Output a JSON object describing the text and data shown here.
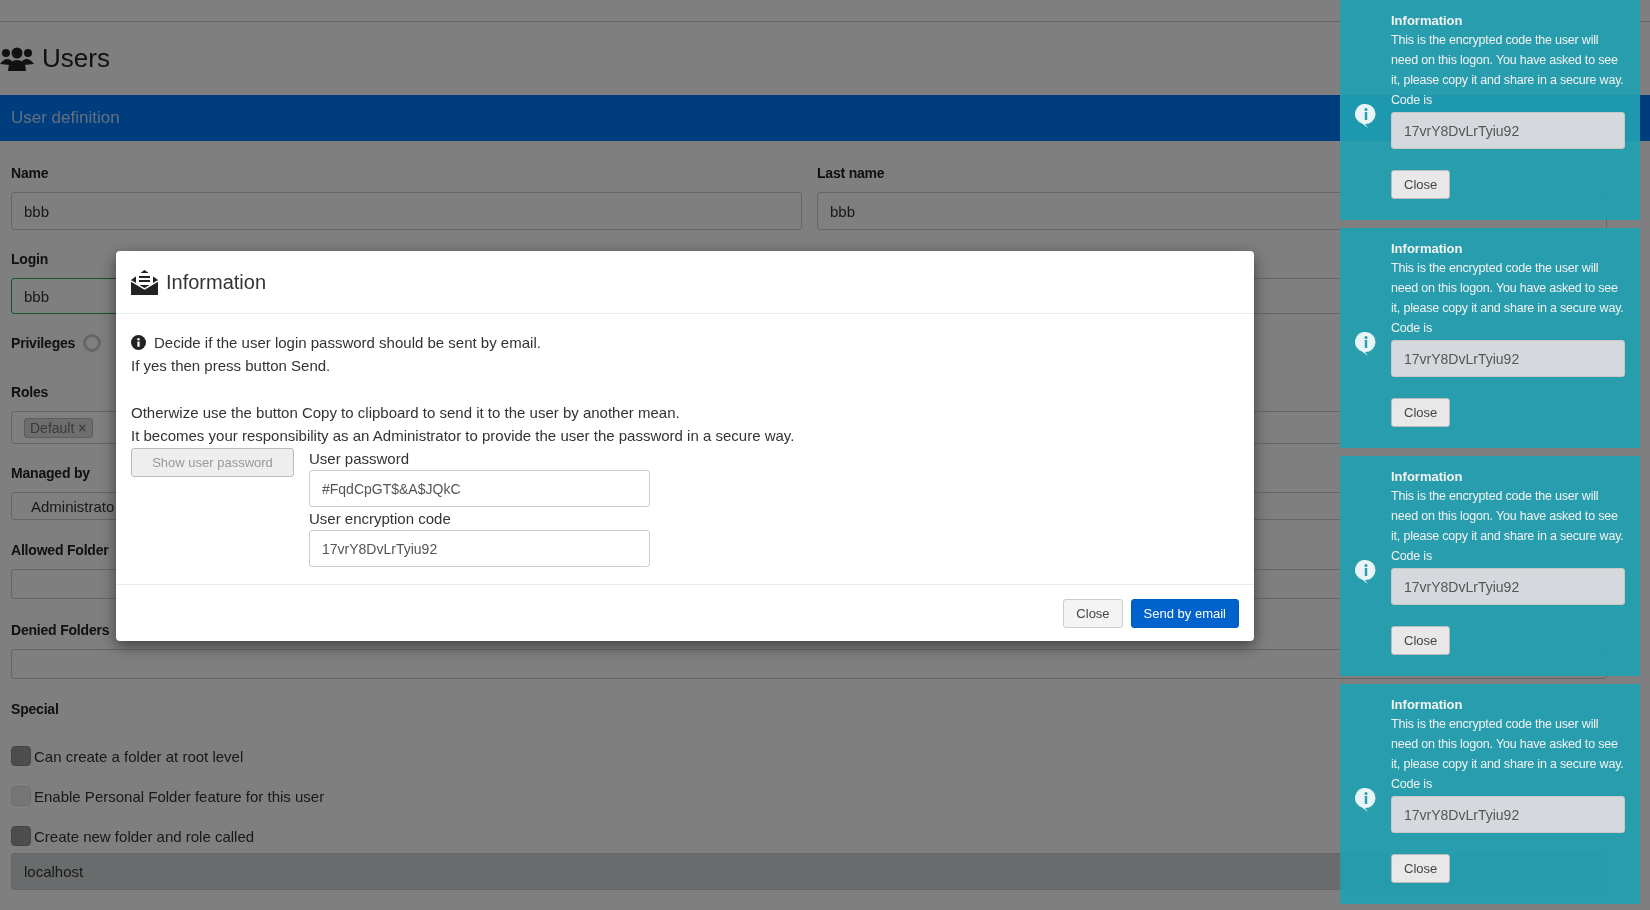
{
  "page": {
    "title": "Users"
  },
  "section": {
    "title": "User definition"
  },
  "form": {
    "name": {
      "label": "Name",
      "value": "bbb"
    },
    "last_name": {
      "label": "Last name",
      "value": "bbb"
    },
    "login": {
      "label": "Login",
      "value": "bbb",
      "valid": true
    },
    "privileges": {
      "label": "Privileges",
      "options": [
        {
          "selected": false
        }
      ]
    },
    "roles": {
      "label": "Roles",
      "tags": [
        {
          "label": "Default",
          "remove": "×"
        }
      ]
    },
    "managed_by": {
      "label": "Managed by",
      "value": "Administrato"
    },
    "allowed_folders": {
      "label": "Allowed Folder"
    },
    "denied_folders": {
      "label": "Denied Folders"
    },
    "special": {
      "label": "Special",
      "options": [
        {
          "label": "Can create a folder at root level",
          "checked": false,
          "disabled": false
        },
        {
          "label": "Enable Personal Folder feature for this user",
          "checked": false,
          "disabled": true
        },
        {
          "label": "Create new folder and role called",
          "checked": false,
          "disabled": false
        }
      ]
    },
    "new_folder": {
      "value": "localhost",
      "disabled": true
    }
  },
  "modal": {
    "title": "Information",
    "intro": [
      "Decide if the user login password should be sent by email.",
      "If yes then press button Send."
    ],
    "details": [
      "Otherwize use the button Copy to clipboard to send it to the user by another mean.",
      "It becomes your responsibility as an Administrator to provide the user the password in a secure way."
    ],
    "show_button": {
      "label": "Show user password",
      "disabled": true
    },
    "fields": [
      {
        "label": "User password",
        "value": "#FqdCpGT$&A$JQkC"
      },
      {
        "label": "User encryption code",
        "value": "17vrY8DvLrTyiu92"
      }
    ],
    "buttons": [
      {
        "label": "Close",
        "kind": "secondary"
      },
      {
        "label": "Send by email",
        "kind": "primary"
      }
    ]
  },
  "toasts": [
    {
      "title": "Information",
      "message": "This is the encrypted code the user will need on this logon. You have asked to see it, please copy it and share in a secure way. Code is",
      "code": "17vrY8DvLrTyiu92",
      "button": "Close"
    },
    {
      "title": "Information",
      "message": "This is the encrypted code the user will need on this logon. You have asked to see it, please copy it and share in a secure way. Code is",
      "code": "17vrY8DvLrTyiu92",
      "button": "Close"
    },
    {
      "title": "Information",
      "message": "This is the encrypted code the user will need on this logon. You have asked to see it, please copy it and share in a secure way. Code is",
      "code": "17vrY8DvLrTyiu92",
      "button": "Close"
    },
    {
      "title": "Information",
      "message": "This is the encrypted code the user will need on this logon. You have asked to see it, please copy it and share in a secure way. Code is",
      "code": "17vrY8DvLrTyiu92",
      "button": "Close"
    }
  ]
}
